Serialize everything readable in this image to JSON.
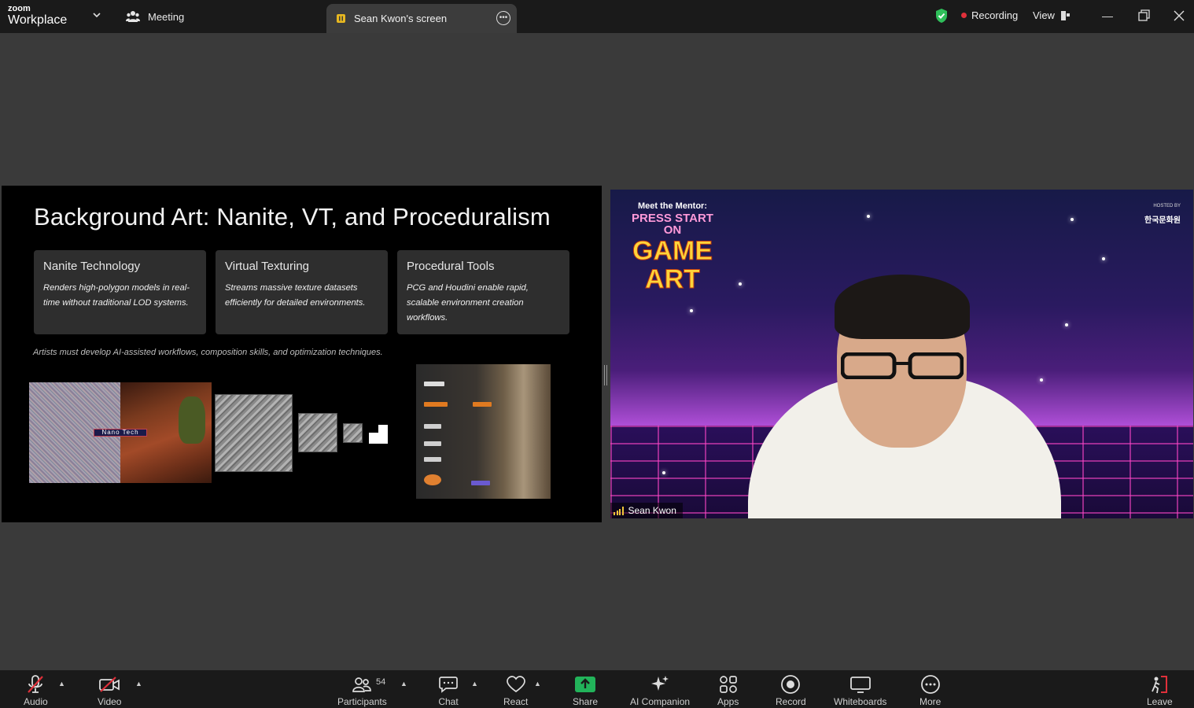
{
  "titlebar": {
    "brand_small": "zoom",
    "brand_large": "Workplace",
    "meeting_label": "Meeting",
    "share_tab_label": "Sean Kwon's screen",
    "recording_label": "Recording",
    "view_label": "View"
  },
  "slide": {
    "title": "Background Art: Nanite, VT, and Proceduralism",
    "cards": [
      {
        "title": "Nanite Technology",
        "body": "Renders high-polygon models in real-time without traditional LOD systems."
      },
      {
        "title": "Virtual Texturing",
        "body": "Streams massive texture datasets efficiently for detailed environments."
      },
      {
        "title": "Procedural Tools",
        "body": "PCG and Houdini enable rapid, scalable environment creation workflows."
      }
    ],
    "tagline": "Artists must develop AI-assisted workflows, composition skills, and optimization techniques.",
    "image_tag": "Nano Tech"
  },
  "webcam": {
    "participant_name": "Sean Kwon",
    "poster_line1": "Meet the Mentor:",
    "poster_line2": "PRESS START ON",
    "poster_line3": "GAME",
    "poster_line4": "ART",
    "hosted_by": "HOSTED BY",
    "host_org": "한국문화원"
  },
  "toolbar": {
    "audio": "Audio",
    "video": "Video",
    "participants": "Participants",
    "participant_count": "54",
    "chat": "Chat",
    "react": "React",
    "share": "Share",
    "ai_companion": "AI Companion",
    "apps": "Apps",
    "record": "Record",
    "whiteboards": "Whiteboards",
    "more": "More",
    "leave": "Leave"
  },
  "colors": {
    "share_green": "#22b35a",
    "leave_red": "#e0303a",
    "recording_red": "#e0303a",
    "shield_green": "#2fbf5a"
  }
}
